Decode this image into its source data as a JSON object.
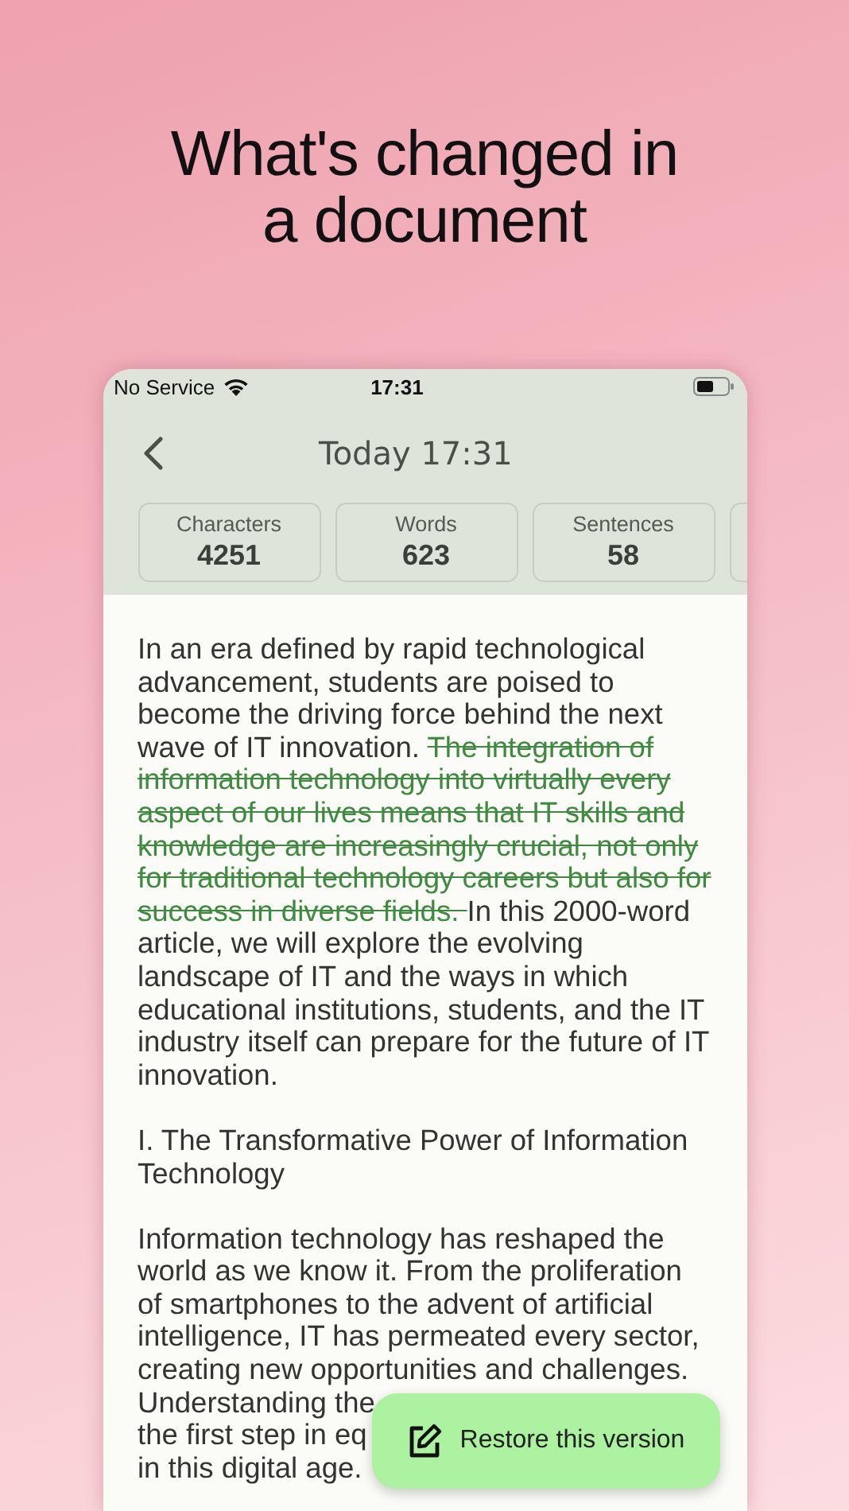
{
  "headline": "What's changed in a document",
  "status_bar": {
    "carrier": "No Service",
    "time": "17:31"
  },
  "header": {
    "title": "Today 17:31"
  },
  "stats": [
    {
      "label": "Characters",
      "value": "4251"
    },
    {
      "label": "Words",
      "value": "623"
    },
    {
      "label": "Sentences",
      "value": "58"
    }
  ],
  "paragraphs": [
    {
      "segments": [
        {
          "text": "In an era defined by rapid technological advancement, students are poised to become the driving force behind the next wave of IT innovation. ",
          "deleted": false
        },
        {
          "text": "The integration of information technology into virtually every aspect of our lives means that IT skills and knowledge are increasingly crucial, not only for traditional technology careers but also for success in diverse fields. ",
          "deleted": true
        },
        {
          "text": "In this 2000-word article, we will explore the evolving landscape of IT and the ways in which educational institutions, students, and the IT industry itself can prepare for the future of IT innovation.",
          "deleted": false
        }
      ]
    },
    {
      "segments": [
        {
          "text": "I. The Transformative Power of Information Technology",
          "deleted": false
        }
      ]
    },
    {
      "segments": [
        {
          "text": "Information technology has reshaped the world as we know it. From the proliferation of smartphones to the advent of artificial intelligence, IT has permeated every sector, creating new opportunities and challenges.",
          "deleted": false
        }
      ]
    }
  ],
  "partial_lines": [
    "Understanding the",
    "the first step in eq",
    "in this digital age."
  ],
  "restore_button": {
    "label": "Restore this version"
  }
}
